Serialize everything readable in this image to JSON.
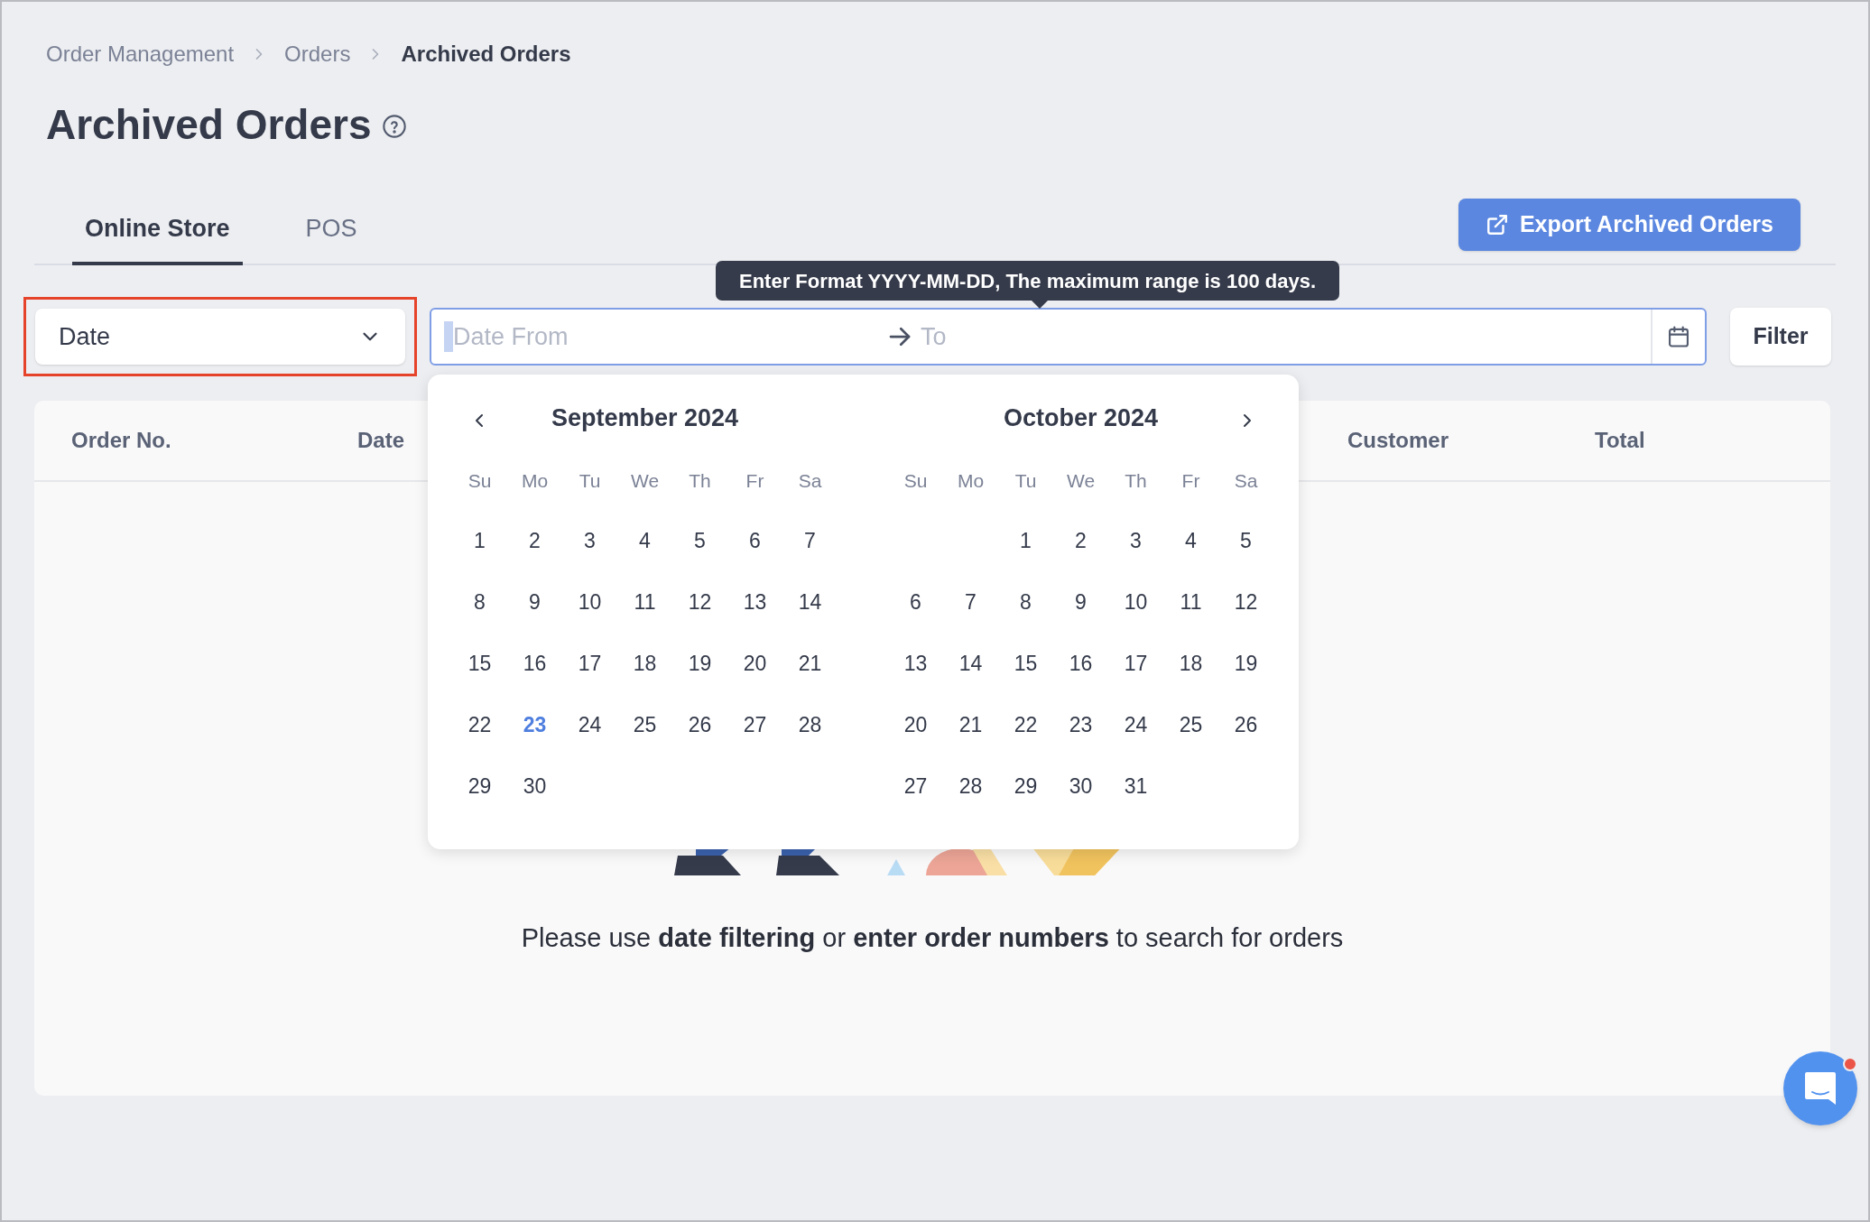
{
  "breadcrumb": [
    {
      "label": "Order Management",
      "current": false
    },
    {
      "label": "Orders",
      "current": false
    },
    {
      "label": "Archived Orders",
      "current": true
    }
  ],
  "title": "Archived Orders",
  "tabs": [
    {
      "label": "Online Store",
      "selected": true
    },
    {
      "label": "POS",
      "selected": false
    }
  ],
  "export_button": "Export Archived Orders",
  "filter": {
    "field_select": "Date",
    "date_from": {
      "placeholder": "Date From"
    },
    "date_to": {
      "placeholder": "To"
    },
    "tooltip": "Enter Format YYYY-MM-DD, The maximum range is 100 days.",
    "button": "Filter"
  },
  "calendar": {
    "months": [
      {
        "title": "September 2024",
        "weekdays": [
          "Su",
          "Mo",
          "Tu",
          "We",
          "Th",
          "Fr",
          "Sa"
        ],
        "weeks": [
          [
            {
              "label": "1",
              "today": false
            },
            {
              "label": "2",
              "today": false
            },
            {
              "label": "3",
              "today": false
            },
            {
              "label": "4",
              "today": false
            },
            {
              "label": "5",
              "today": false
            },
            {
              "label": "6",
              "today": false
            },
            {
              "label": "7",
              "today": false
            }
          ],
          [
            {
              "label": "8",
              "today": false
            },
            {
              "label": "9",
              "today": false
            },
            {
              "label": "10",
              "today": false
            },
            {
              "label": "11",
              "today": false
            },
            {
              "label": "12",
              "today": false
            },
            {
              "label": "13",
              "today": false
            },
            {
              "label": "14",
              "today": false
            }
          ],
          [
            {
              "label": "15",
              "today": false
            },
            {
              "label": "16",
              "today": false
            },
            {
              "label": "17",
              "today": false
            },
            {
              "label": "18",
              "today": false
            },
            {
              "label": "19",
              "today": false
            },
            {
              "label": "20",
              "today": false
            },
            {
              "label": "21",
              "today": false
            }
          ],
          [
            {
              "label": "22",
              "today": false
            },
            {
              "label": "23",
              "today": true
            },
            {
              "label": "24",
              "today": false
            },
            {
              "label": "25",
              "today": false
            },
            {
              "label": "26",
              "today": false
            },
            {
              "label": "27",
              "today": false
            },
            {
              "label": "28",
              "today": false
            }
          ],
          [
            {
              "label": "29",
              "today": false
            },
            {
              "label": "30",
              "today": false
            }
          ]
        ]
      },
      {
        "title": "October 2024",
        "weekdays": [
          "Su",
          "Mo",
          "Tu",
          "We",
          "Th",
          "Fr",
          "Sa"
        ],
        "weeks": [
          [
            {
              "label": "1",
              "today": false
            },
            {
              "label": "2",
              "today": false
            },
            {
              "label": "3",
              "today": false
            },
            {
              "label": "4",
              "today": false
            },
            {
              "label": "5",
              "today": false
            }
          ],
          [
            {
              "label": "6",
              "today": false
            },
            {
              "label": "7",
              "today": false
            },
            {
              "label": "8",
              "today": false
            },
            {
              "label": "9",
              "today": false
            },
            {
              "label": "10",
              "today": false
            },
            {
              "label": "11",
              "today": false
            },
            {
              "label": "12",
              "today": false
            }
          ],
          [
            {
              "label": "13",
              "today": false
            },
            {
              "label": "14",
              "today": false
            },
            {
              "label": "15",
              "today": false
            },
            {
              "label": "16",
              "today": false
            },
            {
              "label": "17",
              "today": false
            },
            {
              "label": "18",
              "today": false
            },
            {
              "label": "19",
              "today": false
            }
          ],
          [
            {
              "label": "20",
              "today": false
            },
            {
              "label": "21",
              "today": false
            },
            {
              "label": "22",
              "today": false
            },
            {
              "label": "23",
              "today": false
            },
            {
              "label": "24",
              "today": false
            },
            {
              "label": "25",
              "today": false
            },
            {
              "label": "26",
              "today": false
            }
          ],
          [
            {
              "label": "27",
              "today": false
            },
            {
              "label": "28",
              "today": false
            },
            {
              "label": "29",
              "today": false
            },
            {
              "label": "30",
              "today": false
            },
            {
              "label": "31",
              "today": false
            }
          ]
        ]
      }
    ]
  },
  "table": {
    "columns": [
      {
        "label": "Order No."
      },
      {
        "label": "Date"
      },
      {
        "label": "Customer"
      },
      {
        "label": "Total"
      }
    ],
    "empty_message": "Please use **date filtering** or **enter order numbers** to search for orders"
  },
  "chat": {
    "unread": true
  }
}
